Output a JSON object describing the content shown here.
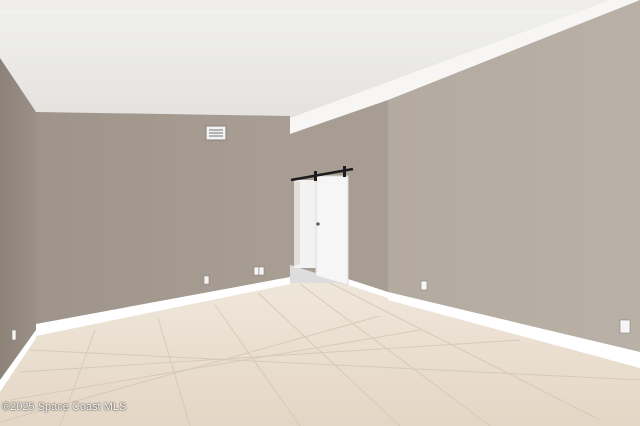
{
  "watermark": {
    "text": "©2025 Space Coast MLS"
  },
  "colors": {
    "ceiling": "#ecebe9",
    "wall": "#a79c91",
    "baseboard": "#ffffff",
    "floor": "#e9dccd",
    "door": "#f4f4f4",
    "barn_rail": "#1c1c1c"
  },
  "icons": [
    "air-vent-icon",
    "electrical-outlet-icon",
    "barn-door-rail-icon"
  ]
}
